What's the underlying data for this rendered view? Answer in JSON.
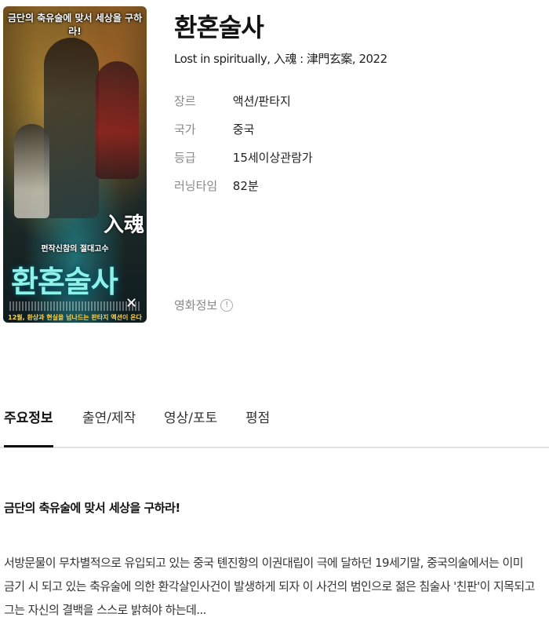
{
  "poster": {
    "tagline": "금단의 축유술에 맞서 세상을 구하라!",
    "calligraphy": "入魂",
    "sub": "펀작신참의 절대고수",
    "big_title": "환혼술사",
    "bottom": "12월, 환상과 현실을 넘나드는 판타지 액션이 온다"
  },
  "movie": {
    "title": "환혼술사",
    "subtitle": "Lost in spiritually, 入魂 : 津門玄案, 2022"
  },
  "info": {
    "genre_label": "장르",
    "genre": "액션/판타지",
    "country_label": "국가",
    "country": "중국",
    "rating_label": "등급",
    "rating": "15세이상관람가",
    "runtime_label": "러닝타임",
    "runtime": "82분"
  },
  "more_info": {
    "label": "영화정보",
    "icon": "!"
  },
  "tabs": [
    "주요정보",
    "출연/제작",
    "영상/포토",
    "평점"
  ],
  "headline": "금단의 축유술에 맞서 세상을 구하라!",
  "synopsis": "서방문물이 무차별적으로 유입되고 있는 중국 톈진항의 이권대립이 극에 달하던 19세기말, 중국의술에서는 이미 금기 시 되고 있는 축유술에 의한 환각살인사건이 발생하게 되자 이 사건의 범인으로 젊은 침술사 '친판'이 지목되고 그는 자신의 결백을 스스로 밝혀야 하는데..."
}
